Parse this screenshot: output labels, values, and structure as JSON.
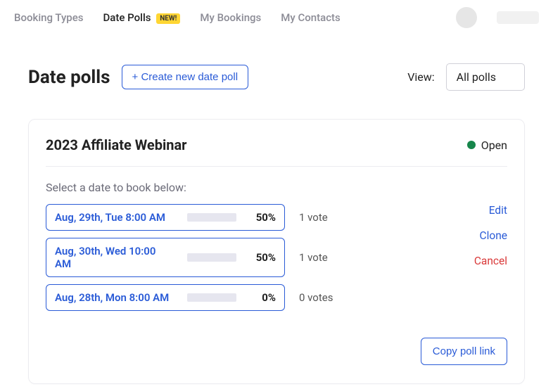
{
  "nav": {
    "items": [
      {
        "label": "Booking Types",
        "active": false
      },
      {
        "label": "Date Polls",
        "active": true,
        "badge": "NEW!"
      },
      {
        "label": "My Bookings",
        "active": false
      },
      {
        "label": "My Contacts",
        "active": false
      }
    ]
  },
  "header": {
    "title": "Date polls",
    "create_label": "+ Create new date poll",
    "view_label": "View:",
    "view_value": "All polls"
  },
  "poll": {
    "title": "2023 Affiliate Webinar",
    "status_label": "Open",
    "status_color": "#17864b",
    "subhead": "Select a date to book below:",
    "options": [
      {
        "label": "Aug, 29th, Tue 8:00 AM",
        "percent": 50,
        "percent_label": "50%",
        "votes_label": "1 vote"
      },
      {
        "label": "Aug, 30th, Wed 10:00 AM",
        "percent": 50,
        "percent_label": "50%",
        "votes_label": "1 vote"
      },
      {
        "label": "Aug, 28th, Mon 8:00 AM",
        "percent": 0,
        "percent_label": "0%",
        "votes_label": "0 votes"
      }
    ],
    "actions": {
      "edit": "Edit",
      "clone": "Clone",
      "cancel": "Cancel",
      "copy_link": "Copy poll link"
    }
  }
}
